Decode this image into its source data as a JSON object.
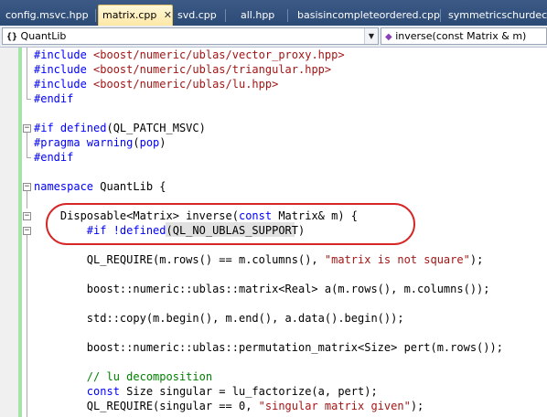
{
  "tabs": [
    {
      "label": "config.msvc.hpp",
      "active": false
    },
    {
      "label": "matrix.cpp",
      "active": true
    },
    {
      "label": "svd.cpp",
      "active": false
    },
    {
      "label": "all.hpp",
      "active": false
    },
    {
      "label": "basisincompleteordered.cpp",
      "active": false
    },
    {
      "label": "symmetricschurdecomp",
      "active": false
    }
  ],
  "nav": {
    "scope_icon": "{}",
    "scope": "QuantLib",
    "member": "inverse(const Matrix & m)"
  },
  "icons": {
    "tab_close": "close-icon",
    "dropdown": "chevron-down-icon",
    "scope": "namespace-icon",
    "member": "method-icon",
    "fold_open": "collapse-icon"
  },
  "colors": {
    "keyword": "#0000ff",
    "string": "#a31515",
    "comment": "#008000",
    "ellipse": "#d62626",
    "changebar": "#a6e3a6"
  },
  "code": {
    "l1": [
      {
        "t": "#include ",
        "c": "kw"
      },
      {
        "t": "<boost/numeric/ublas/vector_proxy.hpp>",
        "c": "str"
      }
    ],
    "l2": [
      {
        "t": "#include ",
        "c": "kw"
      },
      {
        "t": "<boost/numeric/ublas/triangular.hpp>",
        "c": "str"
      }
    ],
    "l3": [
      {
        "t": "#include ",
        "c": "kw"
      },
      {
        "t": "<boost/numeric/ublas/lu.hpp>",
        "c": "str"
      }
    ],
    "l4": [
      {
        "t": "#endif",
        "c": "kw"
      }
    ],
    "l5": [
      {
        "t": "#if defined",
        "c": "kw"
      },
      {
        "t": "(QL_PATCH_MSVC)",
        "c": ""
      }
    ],
    "l6": [
      {
        "t": "#pragma warning",
        "c": "kw"
      },
      {
        "t": "(",
        "c": ""
      },
      {
        "t": "pop",
        "c": "kw"
      },
      {
        "t": ")",
        "c": ""
      }
    ],
    "l7": [
      {
        "t": "#endif",
        "c": "kw"
      }
    ],
    "l8": [
      {
        "t": "namespace",
        "c": "kw"
      },
      {
        "t": " QuantLib {",
        "c": ""
      }
    ],
    "l9": [
      {
        "t": "    Disposable<Matrix> inverse(",
        "c": ""
      },
      {
        "t": "const",
        "c": "kw"
      },
      {
        "t": " Matrix& m) {",
        "c": ""
      }
    ],
    "l10": [
      {
        "t": "        #if !defined",
        "c": "kw"
      },
      {
        "t": "(QL_NO_UBLAS_SUPPORT)",
        "c": ""
      }
    ],
    "l11": [
      {
        "t": "        QL_REQUIRE(m.rows() == m.columns(), ",
        "c": ""
      },
      {
        "t": "\"matrix is not square\"",
        "c": "str"
      },
      {
        "t": ");",
        "c": ""
      }
    ],
    "l12": [
      {
        "t": "        boost::numeric::ublas::matrix<Real> a(m.rows(), m.columns());",
        "c": ""
      }
    ],
    "l13": [
      {
        "t": "        std::copy(m.begin(), m.end(), a.data().begin());",
        "c": ""
      }
    ],
    "l14": [
      {
        "t": "        boost::numeric::ublas::permutation_matrix<Size> pert(m.rows());",
        "c": ""
      }
    ],
    "l15": [
      {
        "t": "        // lu decomposition",
        "c": "cmt"
      }
    ],
    "l16": [
      {
        "t": "        ",
        "c": ""
      },
      {
        "t": "const",
        "c": "kw"
      },
      {
        "t": " Size singular = lu_factorize(a, pert);",
        "c": ""
      }
    ],
    "l17": [
      {
        "t": "        QL_REQUIRE(singular == 0, ",
        "c": ""
      },
      {
        "t": "\"singular matrix given\"",
        "c": "str"
      },
      {
        "t": ");",
        "c": ""
      }
    ]
  }
}
